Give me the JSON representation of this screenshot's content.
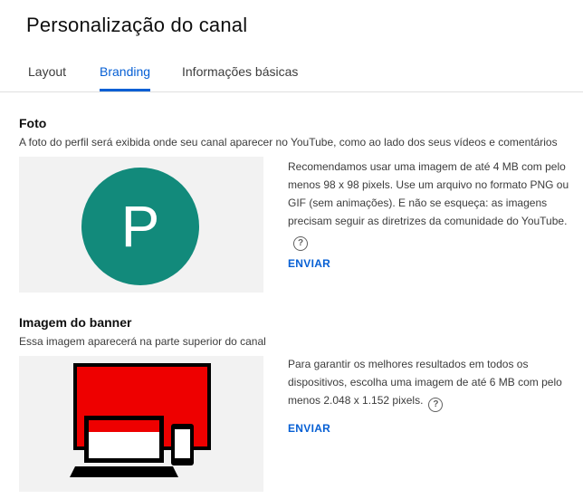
{
  "page": {
    "title": "Personalização do canal"
  },
  "tabs": [
    {
      "label": "Layout",
      "active": false
    },
    {
      "label": "Branding",
      "active": true
    },
    {
      "label": "Informações básicas",
      "active": false
    }
  ],
  "photo_section": {
    "title": "Foto",
    "description": "A foto do perfil será exibida onde seu canal aparecer no YouTube, como ao lado dos seus vídeos e comentários",
    "avatar_letter": "P",
    "avatar_color": "#128a7b",
    "info": "Recomendamos usar uma imagem de até 4 MB com pelo menos 98 x 98 pixels. Use um arquivo no formato PNG ou GIF (sem animações). E não se esqueça: as imagens precisam seguir as diretrizes da comunidade do YouTube.",
    "help_symbol": "?",
    "upload_label": "ENVIAR"
  },
  "banner_section": {
    "title": "Imagem do banner",
    "description": "Essa imagem aparecerá na parte superior do canal",
    "info": "Para garantir os melhores resultados em todos os dispositivos, escolha uma imagem de até 6 MB com pelo menos 2.048 x 1.152 pixels.",
    "help_symbol": "?",
    "upload_label": "ENVIAR"
  },
  "colors": {
    "accent": "#065fd4",
    "banner_red": "#ee0000"
  }
}
